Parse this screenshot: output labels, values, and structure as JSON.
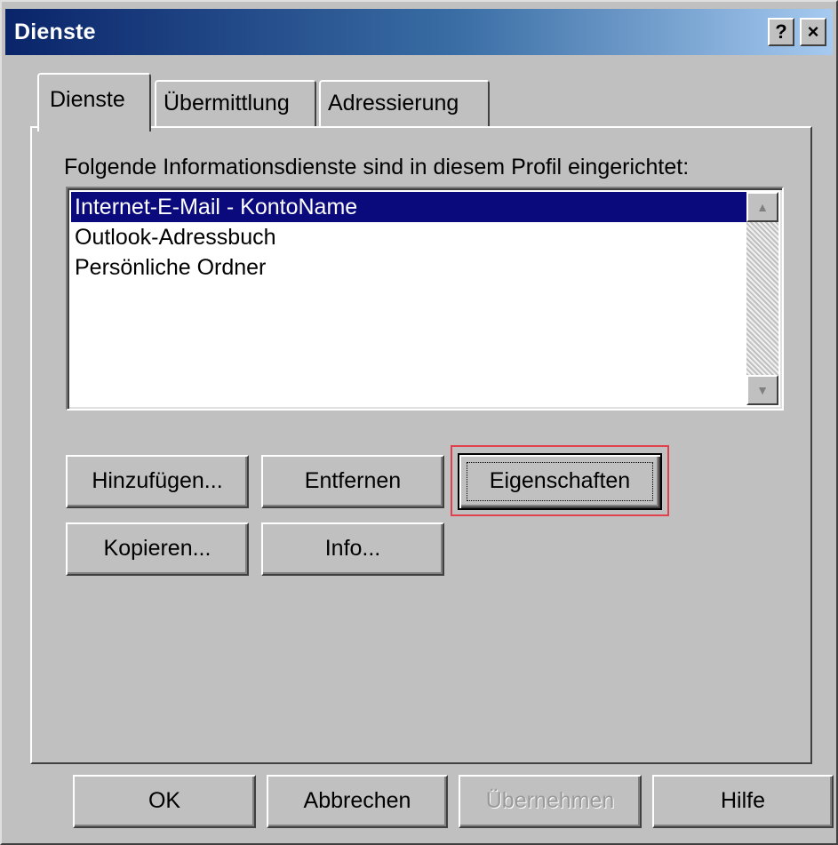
{
  "window": {
    "title": "Dienste",
    "help_button": "?",
    "close_button": "×"
  },
  "tabs": [
    {
      "label": "Dienste",
      "active": true
    },
    {
      "label": "Übermittlung",
      "active": false
    },
    {
      "label": "Adressierung",
      "active": false
    }
  ],
  "services": {
    "label": "Folgende Informationsdienste sind in diesem Profil eingerichtet:",
    "items": [
      {
        "label": "Internet-E-Mail - KontoName",
        "selected": true
      },
      {
        "label": "Outlook-Adressbuch",
        "selected": false
      },
      {
        "label": "Persönliche Ordner",
        "selected": false
      }
    ]
  },
  "actions": {
    "add": "Hinzufügen...",
    "remove": "Entfernen",
    "properties": "Eigenschaften",
    "copy": "Kopieren...",
    "info": "Info..."
  },
  "footer": {
    "ok": "OK",
    "cancel": "Abbrechen",
    "apply": "Übernehmen",
    "help": "Hilfe"
  },
  "colors": {
    "selection": "#0a0a7c",
    "highlight_frame": "#e0414d"
  },
  "icons": {
    "scroll_up": "up-arrow-icon",
    "scroll_down": "down-arrow-icon"
  }
}
